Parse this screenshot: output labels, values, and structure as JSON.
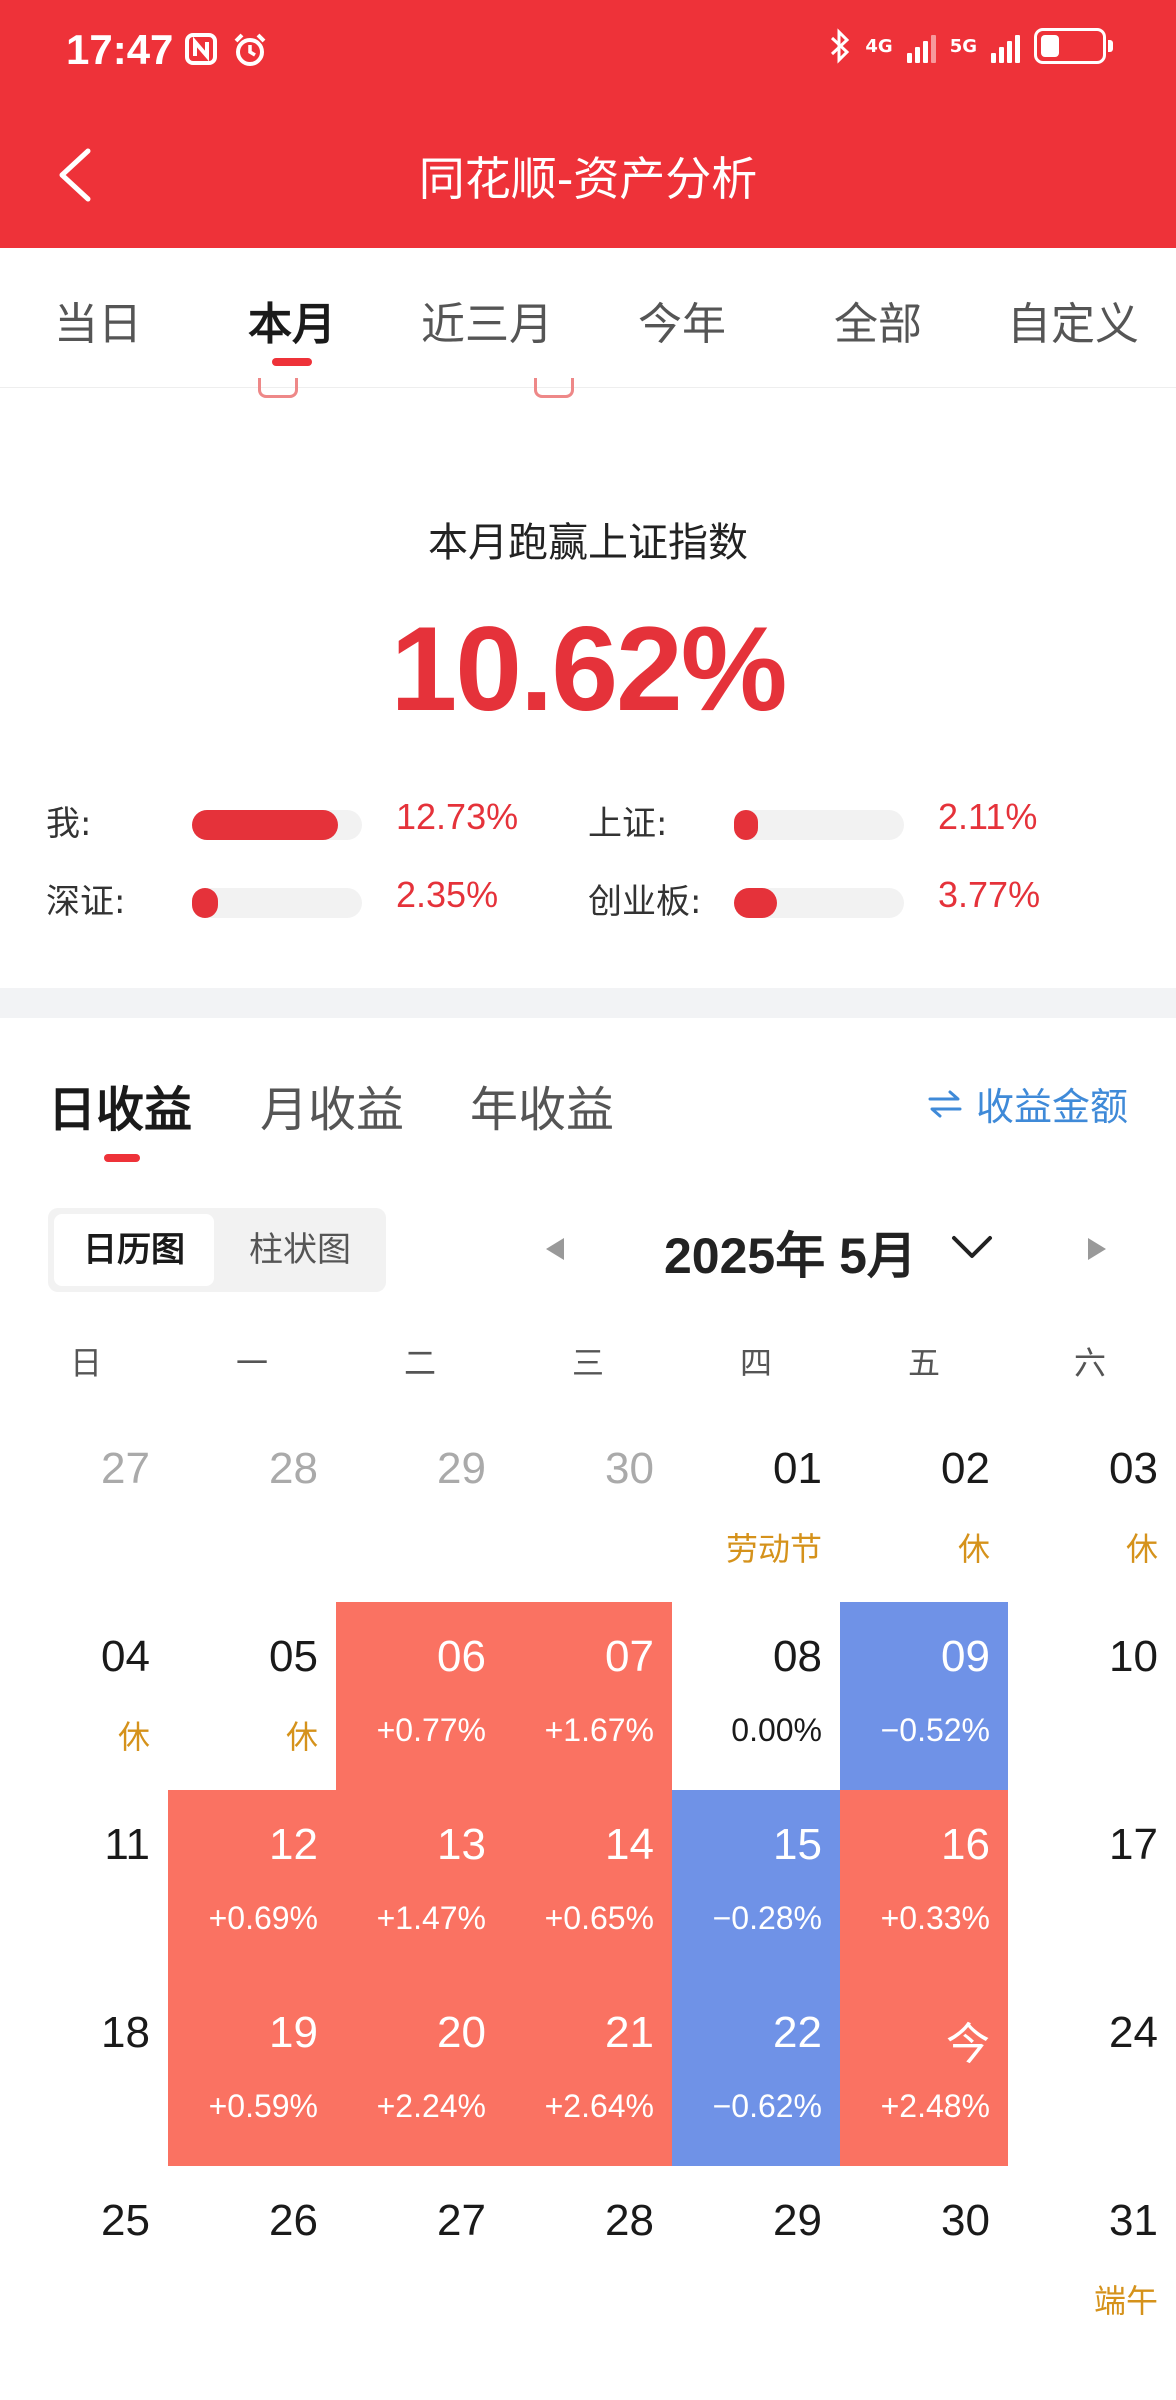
{
  "status_bar": {
    "time": "17:47",
    "net1": "4G",
    "net2": "5G"
  },
  "header": {
    "title": "同花顺-资产分析"
  },
  "tabs": [
    {
      "label": "当日"
    },
    {
      "label": "本月",
      "active": true
    },
    {
      "label": "近三月"
    },
    {
      "label": "今年"
    },
    {
      "label": "全部"
    },
    {
      "label": "自定义"
    }
  ],
  "summary": {
    "label": "本月跑赢上证指数",
    "value": "10.62%",
    "comparisons": [
      {
        "label": "我:",
        "value": "12.73%",
        "level": 0.86
      },
      {
        "label": "上证:",
        "value": "2.11%",
        "level": 0.14
      },
      {
        "label": "深证:",
        "value": "2.35%",
        "level": 0.15
      },
      {
        "label": "创业板:",
        "value": "3.77%",
        "level": 0.25
      }
    ]
  },
  "earnings": {
    "tabs": [
      {
        "label": "日收益",
        "active": true
      },
      {
        "label": "月收益"
      },
      {
        "label": "年收益"
      }
    ],
    "amount_toggle": "收益金额",
    "views": [
      "日历图",
      "柱状图"
    ],
    "month_label": "2025年 5月"
  },
  "calendar": {
    "weekdays": [
      "日",
      "一",
      "二",
      "三",
      "四",
      "五",
      "六"
    ],
    "weeks": [
      [
        {
          "d": "27",
          "prev": true
        },
        {
          "d": "28",
          "prev": true
        },
        {
          "d": "29",
          "prev": true
        },
        {
          "d": "30",
          "prev": true
        },
        {
          "d": "01",
          "sub": "劳动节",
          "t": "holiday"
        },
        {
          "d": "02",
          "sub": "休",
          "t": "holiday"
        },
        {
          "d": "03",
          "sub": "休",
          "t": "holiday"
        }
      ],
      [
        {
          "d": "04",
          "sub": "休",
          "t": "holiday"
        },
        {
          "d": "05",
          "sub": "休",
          "t": "holiday"
        },
        {
          "d": "06",
          "sub": "+0.77%",
          "t": "up"
        },
        {
          "d": "07",
          "sub": "+1.67%",
          "t": "up"
        },
        {
          "d": "08",
          "sub": "0.00%",
          "t": "flat"
        },
        {
          "d": "09",
          "sub": "−0.52%",
          "t": "down"
        },
        {
          "d": "10"
        }
      ],
      [
        {
          "d": "11"
        },
        {
          "d": "12",
          "sub": "+0.69%",
          "t": "up"
        },
        {
          "d": "13",
          "sub": "+1.47%",
          "t": "up"
        },
        {
          "d": "14",
          "sub": "+0.65%",
          "t": "up"
        },
        {
          "d": "15",
          "sub": "−0.28%",
          "t": "down"
        },
        {
          "d": "16",
          "sub": "+0.33%",
          "t": "up"
        },
        {
          "d": "17"
        }
      ],
      [
        {
          "d": "18"
        },
        {
          "d": "19",
          "sub": "+0.59%",
          "t": "up"
        },
        {
          "d": "20",
          "sub": "+2.24%",
          "t": "up"
        },
        {
          "d": "21",
          "sub": "+2.64%",
          "t": "up"
        },
        {
          "d": "22",
          "sub": "−0.62%",
          "t": "down"
        },
        {
          "d": "今",
          "sub": "+2.48%",
          "t": "up"
        },
        {
          "d": "24"
        }
      ],
      [
        {
          "d": "25"
        },
        {
          "d": "26"
        },
        {
          "d": "27"
        },
        {
          "d": "28"
        },
        {
          "d": "29"
        },
        {
          "d": "30"
        },
        {
          "d": "31",
          "sub": "端午",
          "t": "holiday"
        }
      ]
    ]
  },
  "colors": {
    "brand": "#ee3239",
    "gain": "#fa7262",
    "loss": "#6f92e7",
    "holiday": "#d5921b",
    "link": "#3f8ad8"
  }
}
